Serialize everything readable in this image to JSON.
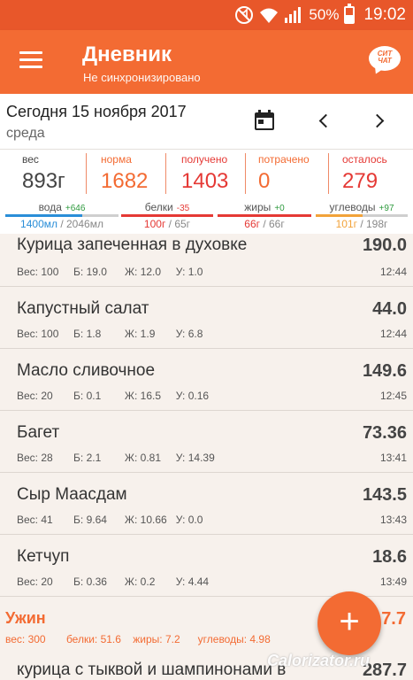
{
  "status_bar": {
    "battery": "50%",
    "time": "19:02",
    "battery_level": 0.5
  },
  "app_bar": {
    "title": "Дневник",
    "subtitle": "Не синхронизировано",
    "chat_label": "СИТ ЧАТ"
  },
  "date": {
    "text": "Сегодня 15 ноября 2017",
    "weekday": "среда"
  },
  "summary": {
    "stats": [
      {
        "label": "вес",
        "value": "893г"
      },
      {
        "label": "норма",
        "value": "1682"
      },
      {
        "label": "получено",
        "value": "1403"
      },
      {
        "label": "потрачено",
        "value": "0"
      },
      {
        "label": "осталось",
        "value": "279"
      }
    ],
    "macros": [
      {
        "label": "вода",
        "delta": "+646",
        "current": "1400мл",
        "total": " / 2046мл",
        "progress": 0.68
      },
      {
        "label": "белки",
        "delta": "-35",
        "current": "100г",
        "total": " / 65г",
        "progress": 1.0
      },
      {
        "label": "жиры",
        "delta": "+0",
        "current": "66г",
        "total": " / 66г",
        "progress": 1.0
      },
      {
        "label": "углеводы",
        "delta": "+97",
        "current": "101г",
        "total": " / 198г",
        "progress": 0.51
      }
    ]
  },
  "items": [
    {
      "name": "Курица запеченная в духовке",
      "calories": "190.0",
      "details": "Вес: 100     Б: 19.0      Ж: 12.0     У: 1.0",
      "time": "12:44"
    },
    {
      "name": "Капустный салат",
      "calories": "44.0",
      "details": "Вес: 100     Б: 1.8        Ж: 1.9       У: 6.8",
      "time": "12:44"
    },
    {
      "name": "Масло сливочное",
      "calories": "149.6",
      "details": "Вес: 20       Б: 0.1        Ж: 16.5     У: 0.16",
      "time": "12:45"
    },
    {
      "name": "Багет",
      "calories": "73.36",
      "details": "Вес: 28       Б: 2.1        Ж: 0.81     У: 14.39",
      "time": "13:41"
    },
    {
      "name": "Сыр Маасдам",
      "calories": "143.5",
      "details": "Вес: 41       Б: 9.64      Ж: 10.66   У: 0.0",
      "time": "13:43"
    },
    {
      "name": "Кетчуп",
      "calories": "18.6",
      "details": "Вес: 20       Б: 0.36      Ж: 0.2       У: 4.44",
      "time": "13:49"
    }
  ],
  "meal": {
    "name": "Ужин",
    "calories": "7.7",
    "details": "вес: 300       белки: 51.6    жиры: 7.2      углеводы: 4.98"
  },
  "next_item": {
    "name": "курица с тыквой и шампинонами в",
    "calories": "287.7"
  },
  "fab_label": "+",
  "watermark": "Calorizator.ru",
  "colors": {
    "accent": "#f36b33",
    "status_bar": "#e8572a",
    "water": "#2a8ed8",
    "protein": "#e53935",
    "fat": "#e53935",
    "carbs": "#f2a33a",
    "red_value": "#e53935"
  }
}
